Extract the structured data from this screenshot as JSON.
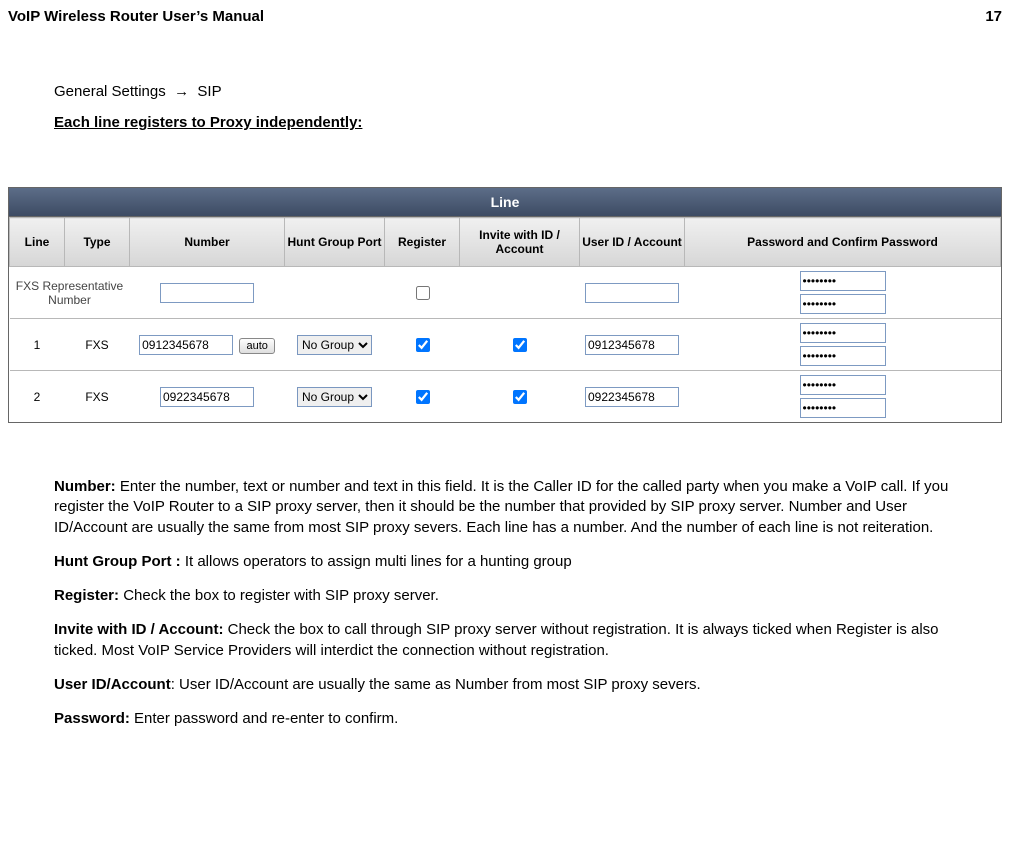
{
  "header": {
    "title": "VoIP Wireless Router User’s Manual",
    "page": "17"
  },
  "breadcrumb": {
    "settings": "General Settings",
    "arrow": "→",
    "sip": "SIP"
  },
  "sub_heading": "Each line registers to Proxy independently:",
  "line_panel": {
    "title": "Line"
  },
  "cols": {
    "c1": "Line",
    "c2": "Type",
    "c3": "Number",
    "c4": "Hunt Group Port",
    "c5": "Register",
    "c6": "Invite with ID / Account",
    "c7": "User ID / Account",
    "c8": "Password and Confirm Password"
  },
  "rows": {
    "rep": {
      "label": "FXS Representative Number",
      "number": "",
      "userid": "",
      "pw1": "••••••••",
      "pw2": "••••••••"
    },
    "r1": {
      "line": "1",
      "type": "FXS",
      "number": "0912345678",
      "auto": "auto",
      "hg": "No Group",
      "userid": "0912345678",
      "pw1": "••••••••",
      "pw2": "••••••••"
    },
    "r2": {
      "line": "2",
      "type": "FXS",
      "number": "0922345678",
      "hg": "No Group",
      "userid": "0922345678",
      "pw1": "••••••••",
      "pw2": "••••••••"
    }
  },
  "desc": {
    "number_label": "Number:",
    "number_text": " Enter the number, text or number and text in this field. It is the Caller ID for the called party when you make a VoIP call. If you register the VoIP Router to a SIP proxy server, then it should be the number that provided by SIP proxy server. Number and User ID/Account are usually the same from most SIP proxy severs. Each line has a number. And the number of each line is not reiteration.",
    "hg_label": "Hunt Group Port :",
    "hg_text": " It allows operators to assign multi lines for a hunting group",
    "reg_label": "Register:",
    "reg_text": " Check the box to register with SIP proxy server.",
    "invite_label": "Invite with ID / Account:",
    "invite_text": " Check the box to call through SIP proxy server without registration. It is always ticked when Register is also ticked. Most VoIP Service Providers will interdict the connection without registration.",
    "userid_label": "User ID/Account",
    "userid_text": ": User ID/Account are usually the same as Number from most SIP proxy severs.",
    "pw_label": "Password:",
    "pw_text": " Enter password and re-enter to confirm."
  }
}
